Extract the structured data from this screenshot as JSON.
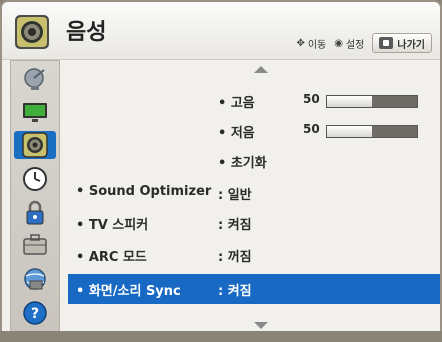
{
  "header": {
    "title": "음성",
    "hint_move": "이동",
    "hint_set": "설정",
    "exit_label": "나가기"
  },
  "sidebar": {
    "items": [
      {
        "icon": "satellite-dish-icon"
      },
      {
        "icon": "monitor-icon"
      },
      {
        "icon": "speaker-icon",
        "active": true
      },
      {
        "icon": "clock-icon"
      },
      {
        "icon": "lock-icon"
      },
      {
        "icon": "toolbox-icon"
      },
      {
        "icon": "network-globe-icon"
      },
      {
        "icon": "help-icon"
      }
    ]
  },
  "menu": {
    "treble": {
      "label": "• 고음",
      "value": "50",
      "level": 0.5
    },
    "bass": {
      "label": "• 저음",
      "value": "50",
      "level": 0.5
    },
    "reset": {
      "label": "• 초기화"
    },
    "sound_optimizer": {
      "label": "• Sound Optimizer",
      "value": ": 일반"
    },
    "tv_speaker": {
      "label": "• TV 스피커",
      "value": ": 켜짐"
    },
    "arc_mode": {
      "label": "• ARC 모드",
      "value": ": 꺼짐"
    },
    "av_sync": {
      "label": "• 화면/소리 Sync",
      "value": ": 켜짐",
      "selected": true
    }
  },
  "colors": {
    "selection": "#1769c3",
    "sidebar_active": "#1a6fc2"
  }
}
